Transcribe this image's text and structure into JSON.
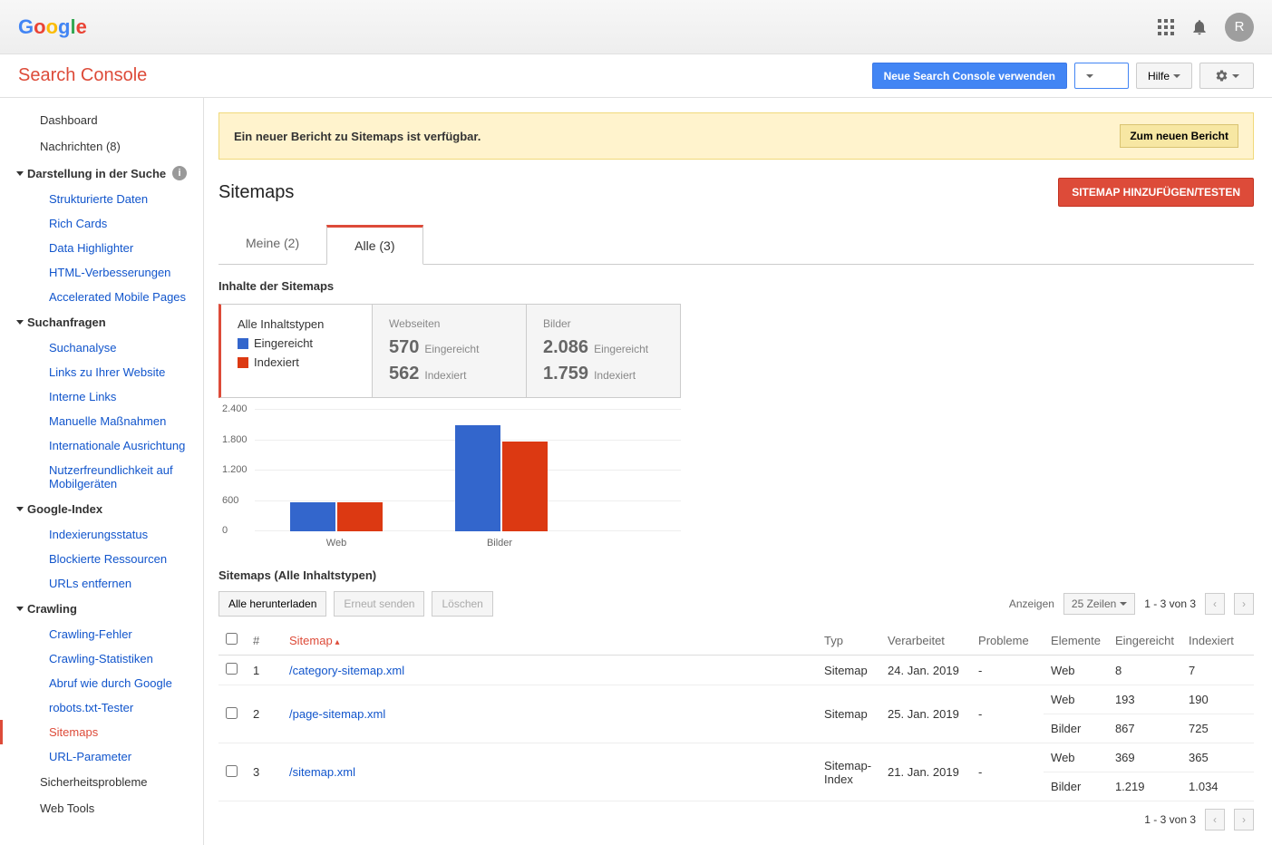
{
  "header": {
    "avatar_initial": "R"
  },
  "subheader": {
    "title": "Search Console",
    "new_console_btn": "Neue Search Console verwenden",
    "help_btn": "Hilfe"
  },
  "sidebar": {
    "dashboard": "Dashboard",
    "messages": "Nachrichten (8)",
    "search_appearance": "Darstellung in der Suche",
    "search_appearance_items": [
      "Strukturierte Daten",
      "Rich Cards",
      "Data Highlighter",
      "HTML-Verbesserungen",
      "Accelerated Mobile Pages"
    ],
    "search_traffic": "Suchanfragen",
    "search_traffic_items": [
      "Suchanalyse",
      "Links zu Ihrer Website",
      "Interne Links",
      "Manuelle Maßnahmen",
      "Internationale Ausrichtung",
      "Nutzerfreundlichkeit auf Mobilgeräten"
    ],
    "google_index": "Google-Index",
    "google_index_items": [
      "Indexierungsstatus",
      "Blockierte Ressourcen",
      "URLs entfernen"
    ],
    "crawling": "Crawling",
    "crawling_items": [
      "Crawling-Fehler",
      "Crawling-Statistiken",
      "Abruf wie durch Google",
      "robots.txt-Tester",
      "Sitemaps",
      "URL-Parameter"
    ],
    "security": "Sicherheitsprobleme",
    "web_tools": "Web Tools"
  },
  "notice": {
    "text": "Ein neuer Bericht zu Sitemaps ist verfügbar.",
    "btn": "Zum neuen Bericht"
  },
  "page": {
    "title": "Sitemaps",
    "add_btn": "SITEMAP HINZUFÜGEN/TESTEN"
  },
  "tabs": {
    "mine": "Meine (2)",
    "all": "Alle (3)"
  },
  "contents": {
    "title": "Inhalte der Sitemaps",
    "legend_title": "Alle Inhaltstypen",
    "submitted": "Eingereicht",
    "indexed": "Indexiert",
    "web_label": "Webseiten",
    "web_submitted": "570",
    "web_indexed": "562",
    "img_label": "Bilder",
    "img_submitted": "2.086",
    "img_indexed": "1.759"
  },
  "chart_data": {
    "type": "bar",
    "categories": [
      "Web",
      "Bilder"
    ],
    "series": [
      {
        "name": "Eingereicht",
        "color": "#3366CC",
        "values": [
          570,
          2086
        ]
      },
      {
        "name": "Indexiert",
        "color": "#DC3912",
        "values": [
          562,
          1759
        ]
      }
    ],
    "y_ticks": [
      0,
      600,
      1200,
      1800,
      2400
    ],
    "ylim": [
      0,
      2400
    ],
    "xlabel": "",
    "ylabel": ""
  },
  "table": {
    "title": "Sitemaps (Alle Inhaltstypen)",
    "download_all": "Alle herunterladen",
    "resend": "Erneut senden",
    "delete": "Löschen",
    "show_label": "Anzeigen",
    "rows_label": "25 Zeilen",
    "range": "1 - 3 von 3",
    "cols": {
      "num": "#",
      "sitemap": "Sitemap",
      "type": "Typ",
      "processed": "Verarbeitet",
      "problems": "Probleme",
      "elements": "Elemente",
      "submitted": "Eingereicht",
      "indexed": "Indexiert"
    },
    "rows": [
      {
        "num": "1",
        "sitemap": "/category-sitemap.xml",
        "type": "Sitemap",
        "processed": "24. Jan. 2019",
        "problems": "-",
        "elements": [
          {
            "el": "Web",
            "sub": "8",
            "idx": "7"
          }
        ]
      },
      {
        "num": "2",
        "sitemap": "/page-sitemap.xml",
        "type": "Sitemap",
        "processed": "25. Jan. 2019",
        "problems": "-",
        "elements": [
          {
            "el": "Web",
            "sub": "193",
            "idx": "190"
          },
          {
            "el": "Bilder",
            "sub": "867",
            "idx": "725"
          }
        ]
      },
      {
        "num": "3",
        "sitemap": "/sitemap.xml",
        "type": "Sitemap-Index",
        "processed": "21. Jan. 2019",
        "problems": "-",
        "elements": [
          {
            "el": "Web",
            "sub": "369",
            "idx": "365"
          },
          {
            "el": "Bilder",
            "sub": "1.219",
            "idx": "1.034"
          }
        ]
      }
    ]
  }
}
